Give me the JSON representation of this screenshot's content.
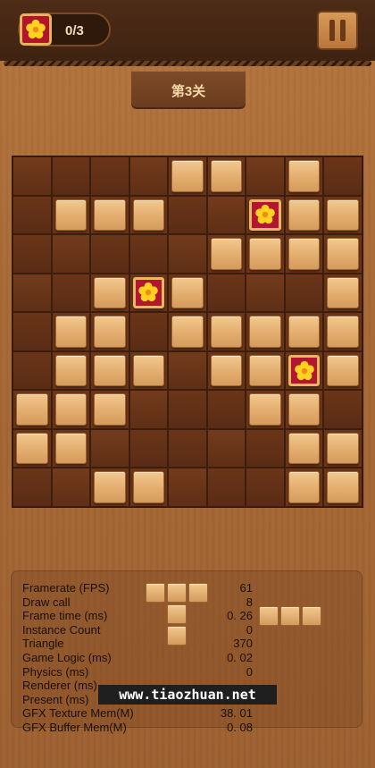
{
  "header": {
    "score_text": "0/3",
    "level_title": "第3关"
  },
  "icons": {
    "score_icon": "flower-icon",
    "pause": "pause-icon",
    "flower_tile": "flower-icon"
  },
  "colors": {
    "flower_tile_bg": "#b31631",
    "flower_tile_border": "#e9b761",
    "flower_petal": "#ffd21f",
    "board_bg": "#4a2512",
    "tile_wood": "#e3ad6e"
  },
  "board": {
    "rows": 9,
    "cols": 9,
    "legend": {
      "0": "empty",
      "1": "wood-block",
      "2": "flower-block"
    },
    "grid": [
      [
        0,
        0,
        0,
        0,
        1,
        1,
        0,
        1,
        0
      ],
      [
        0,
        1,
        1,
        1,
        0,
        0,
        2,
        1,
        1
      ],
      [
        0,
        0,
        0,
        0,
        0,
        1,
        1,
        1,
        1
      ],
      [
        0,
        0,
        1,
        2,
        1,
        0,
        0,
        0,
        1
      ],
      [
        0,
        1,
        1,
        0,
        1,
        1,
        1,
        1,
        1
      ],
      [
        0,
        1,
        1,
        1,
        0,
        1,
        1,
        2,
        1
      ],
      [
        1,
        1,
        1,
        0,
        0,
        0,
        1,
        1,
        0
      ],
      [
        1,
        1,
        0,
        0,
        0,
        0,
        0,
        1,
        1
      ],
      [
        0,
        0,
        1,
        1,
        0,
        0,
        0,
        1,
        1
      ]
    ]
  },
  "pieces": [
    {
      "name": "piece-left",
      "cells": [
        [
          0,
          0
        ],
        [
          0,
          1
        ],
        [
          0,
          2
        ],
        [
          1,
          1
        ],
        [
          2,
          1
        ]
      ]
    },
    {
      "name": "piece-right",
      "cells": [
        [
          0,
          0
        ],
        [
          0,
          1
        ],
        [
          0,
          2
        ]
      ]
    }
  ],
  "stats": [
    {
      "label": "Framerate (FPS)",
      "value": "61"
    },
    {
      "label": "Draw call",
      "value": "8"
    },
    {
      "label": "Frame time (ms)",
      "value": "0. 26"
    },
    {
      "label": "Instance Count",
      "value": "0"
    },
    {
      "label": "Triangle",
      "value": "370"
    },
    {
      "label": "Game Logic (ms)",
      "value": "0. 02"
    },
    {
      "label": "Physics (ms)",
      "value": "0"
    },
    {
      "label": "Renderer (ms)",
      "value": ""
    },
    {
      "label": "Present (ms)",
      "value": ""
    },
    {
      "label": "GFX Texture Mem(M)",
      "value": "38. 01"
    },
    {
      "label": "GFX Buffer Mem(M)",
      "value": "0. 08"
    }
  ],
  "watermark": "www.tiaozhuan.net"
}
